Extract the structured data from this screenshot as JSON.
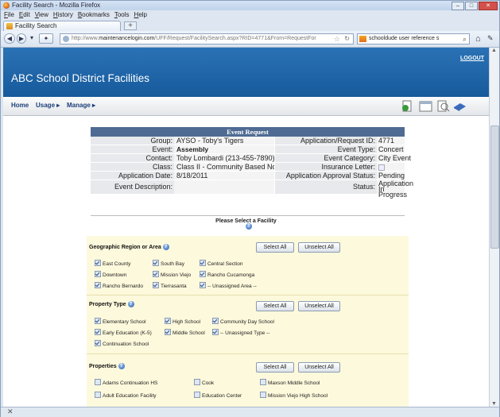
{
  "window": {
    "title": "Facility Search - Mozilla Firefox",
    "controls": [
      "–",
      "□",
      "✕"
    ]
  },
  "menu": [
    "File",
    "Edit",
    "View",
    "History",
    "Bookmarks",
    "Tools",
    "Help"
  ],
  "tab": {
    "label": "Facility Search",
    "new_tab": "+"
  },
  "nav": {
    "url_prefix": "http://www.",
    "url_host": "maintenancelogin.com",
    "url_path": "/UFF/Request/FacilitySearch.aspx?RID=4771&From=RequestFor",
    "search_text": "schooldude user reference s"
  },
  "site": {
    "logout": "LOGOUT",
    "title": "ABC School District Facilities",
    "nav_home": "Home",
    "nav_usage": "Usage ▸",
    "nav_manage": "Manage ▸"
  },
  "event": {
    "header": "Event Request",
    "left": [
      {
        "label": "Group:",
        "value": "AYSO - Toby's Tigers"
      },
      {
        "label": "Event:",
        "value": "Assembly"
      },
      {
        "label": "Contact:",
        "value": "Toby Lombardi (213-455-7890)"
      },
      {
        "label": "Class:",
        "value": "Class II - Community Based Not-For-Profit"
      },
      {
        "label": "Application Date:",
        "value": "8/18/2011"
      },
      {
        "label": "Event Description:",
        "value": ""
      }
    ],
    "right": [
      {
        "label": "Application/Request ID:",
        "value": "4771"
      },
      {
        "label": "Event Type:",
        "value": "Concert"
      },
      {
        "label": "Event Category:",
        "value": "City Event"
      },
      {
        "label": "Insurance Letter:",
        "value": ""
      },
      {
        "label": "Application Approval Status:",
        "value": "Pending"
      },
      {
        "label": "Status:",
        "value": "Application In Progress"
      }
    ]
  },
  "select_facility": "Please Select a Facility",
  "sections": {
    "region": {
      "title": "Geographic Region or Area",
      "select_all": "Select All",
      "unselect_all": "Unselect All",
      "options": [
        "East County",
        "South Bay",
        "Central Section",
        "Downtown",
        "Mission Viejo",
        "Rancho Cucamonga",
        "Rancho Bernardo",
        "Tierrasanta",
        "-- Unassigned Area --"
      ]
    },
    "property_type": {
      "title": "Property Type",
      "select_all": "Select All",
      "unselect_all": "Unselect All",
      "options": [
        "Elementary School",
        "High School",
        "Community Day School",
        "Early Education (K-5)",
        "Middle School",
        "-- Unassigned Type --",
        "Continuation School"
      ]
    },
    "properties": {
      "title": "Properties",
      "select_all": "Select All",
      "unselect_all": "Unselect All",
      "options": [
        "Adams Continuation HS",
        "Cook",
        "Maxson Middle School",
        "Adult Education Facility",
        "Education Center",
        "Mission Viejo High School"
      ]
    }
  },
  "statusbar": {
    "close": "✕"
  }
}
